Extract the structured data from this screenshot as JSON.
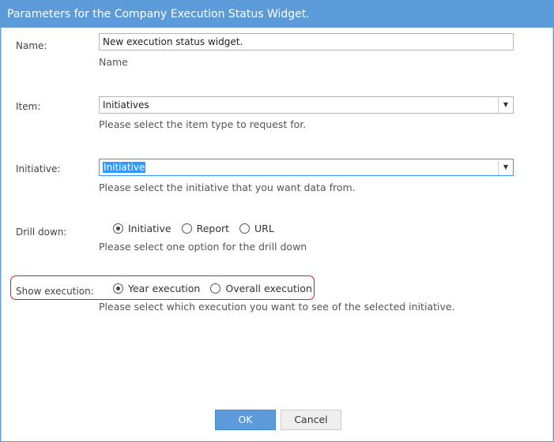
{
  "dialog": {
    "title": "Parameters for the Company Execution Status Widget."
  },
  "name_field": {
    "label": "Name:",
    "value": "New execution status widget.",
    "hint": "Name"
  },
  "item_field": {
    "label": "Item:",
    "value": "Initiatives",
    "hint": "Please select the item type to request for."
  },
  "initiative_field": {
    "label": "Initiative:",
    "value": "Initiative",
    "hint": "Please select the initiative that you want data from."
  },
  "drill_down": {
    "label": "Drill down:",
    "options": [
      "Initiative",
      "Report",
      "URL"
    ],
    "selected": "Initiative",
    "hint": "Please select one option for the drill down"
  },
  "show_execution": {
    "label": "Show execution:",
    "options": [
      "Year execution",
      "Overall execution"
    ],
    "selected": "Year execution",
    "hint": "Please select which execution you want to see of the selected initiative."
  },
  "buttons": {
    "ok": "OK",
    "cancel": "Cancel"
  },
  "colors": {
    "accent": "#5b9bd9",
    "highlight": "#d42020",
    "selection": "#3399ff"
  }
}
